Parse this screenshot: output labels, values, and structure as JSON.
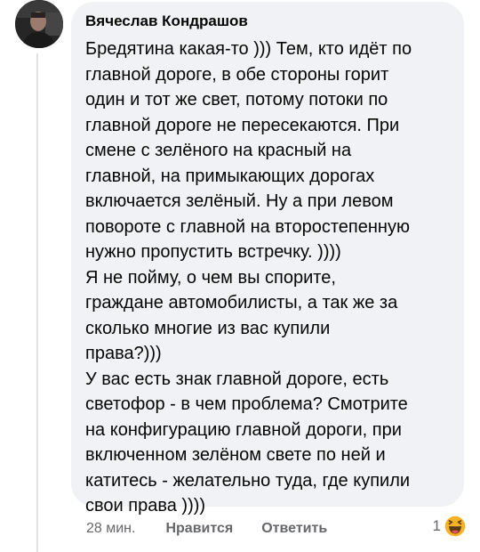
{
  "comment": {
    "author": "Вячеслав Кондрашов",
    "paragraphs": [
      [
        "Бредятина какая-то ))) Тем, кто идёт по",
        "главной дороге, в обе стороны горит",
        "один и тот же свет, потому потоки по",
        "главной дороге не пересекаются. При",
        "смене с зелёного на красный на",
        "главной, на примыкающих дорогах",
        "включается зелёный. Ну а при левом",
        "повороте с главной на второстепенную",
        "нужно пропустить встречку. ))))"
      ],
      [
        "Я не пойму, о чем вы спорите,",
        "граждане автомобилисты, а так же за",
        "сколько многие из вас купили",
        "права?)))"
      ],
      [
        "У вас есть знак главной дороге, есть",
        "светофор - в чем проблема? Смотрите",
        "на конфигурацию главной дороги, при",
        "включенном зелёном свете по ней и",
        "катитесь - желательно туда, где купили",
        "свои права ))))"
      ]
    ]
  },
  "actions": {
    "timestamp": "28 мин.",
    "like_label": "Нравится",
    "reply_label": "Ответить"
  },
  "reactions": {
    "count": "1",
    "icon": "haha-emoji-icon"
  },
  "colors": {
    "bubble_bg": "#f0f2f5",
    "meta_text": "#65676b",
    "emoji_yellow": "#f7b125"
  }
}
